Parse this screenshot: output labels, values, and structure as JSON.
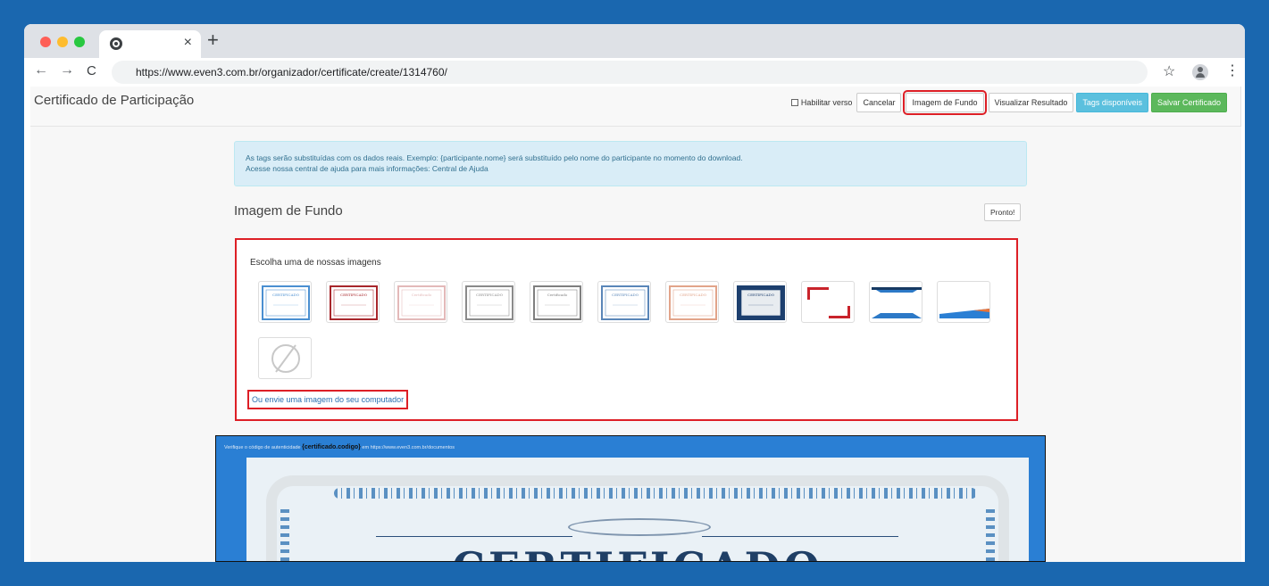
{
  "browser": {
    "url": "https://www.even3.com.br/organizador/certificate/create/1314760/",
    "icons": {
      "close": "close-icon",
      "new_tab": "plus-icon",
      "back": "arrow-left-icon",
      "forward": "arrow-right-icon",
      "reload": "reload-icon",
      "bookmark": "star-icon",
      "profile": "profile-icon",
      "menu": "kebab-menu-icon"
    },
    "glyphs": {
      "close": "×",
      "new_tab": "+",
      "back": "←",
      "forward": "→",
      "reload": "C",
      "bookmark": "☆",
      "menu": "⋮"
    }
  },
  "header": {
    "title": "Certificado de Participação",
    "checkbox_label": "Habilitar verso",
    "checkbox_checked": false,
    "buttons": {
      "cancel": "Cancelar",
      "background_image": "Imagem de Fundo",
      "view_result": "Visualizar Resultado",
      "tags": "Tags disponíveis",
      "save": "Salvar Certificado"
    },
    "colors": {
      "highlight": "#dd1f26",
      "info": "#5bc0de",
      "success": "#5cb85c"
    }
  },
  "alert": {
    "line1": "As tags serão substituídas com os dados reais. Exemplo: {participante.nome} será substituído pelo nome do participante no momento do download.",
    "line2_prefix": "Acesse nossa central de ajuda para mais informações: ",
    "line2_link": "Central de Ajuda"
  },
  "section": {
    "title": "Imagem de Fundo",
    "done_button": "Pronto!"
  },
  "chooser": {
    "label": "Escolha uma de nossas imagens",
    "templates": [
      {
        "name": "template-blue-classic",
        "label": "CERTIFICADO",
        "accent": "#4a8fd1"
      },
      {
        "name": "template-red-frame",
        "label": "CERTIFICADO",
        "accent": "#a8262b"
      },
      {
        "name": "template-pink-light",
        "label": "Certificado",
        "accent": "#e3b9b9"
      },
      {
        "name": "template-gray-ribbon",
        "label": "CERTIFICADO",
        "accent": "#8a8a8a"
      },
      {
        "name": "template-gray-dark-frame",
        "label": "Certificado",
        "accent": "#7f7f7f"
      },
      {
        "name": "template-blue-ornate",
        "label": "CERTIFICADO",
        "accent": "#5a86b8"
      },
      {
        "name": "template-orange-light",
        "label": "CERTIFICADO",
        "accent": "#e2a48a"
      },
      {
        "name": "template-dark-blue",
        "label": "CERTIFICADO",
        "accent": "#1d3f6e"
      },
      {
        "name": "template-red-corners",
        "label": "",
        "accent": "#c9232b"
      },
      {
        "name": "template-blue-bands",
        "label": "",
        "accent": "#2c79c7"
      },
      {
        "name": "template-blue-orange",
        "label": "",
        "accent": "#2a7fd4"
      },
      {
        "name": "template-none",
        "label": "",
        "accent": "#cccccc"
      }
    ],
    "upload_link": "Ou envie uma imagem do seu computador"
  },
  "preview": {
    "note_prefix": "Verifique o código de autenticidade ",
    "note_tag": "{certificado.codigo}",
    "note_suffix": " em https://www.even3.com.br/documentos",
    "title": "CERTIFICADO"
  }
}
